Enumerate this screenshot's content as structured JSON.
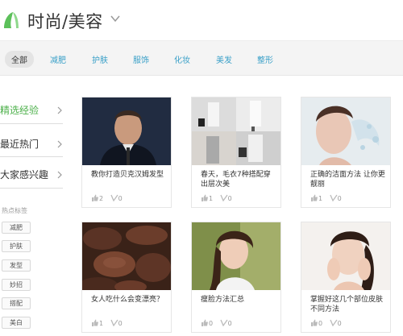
{
  "header": {
    "title": "时尚/美容"
  },
  "categories": [
    {
      "label": "全部",
      "active": true
    },
    {
      "label": "减肥"
    },
    {
      "label": "护肤"
    },
    {
      "label": "服饰"
    },
    {
      "label": "化妆"
    },
    {
      "label": "美发"
    },
    {
      "label": "整形"
    }
  ],
  "sidebar": {
    "items": [
      {
        "label": "精选经验",
        "active": true
      },
      {
        "label": "最近热门"
      },
      {
        "label": "大家感兴趣"
      }
    ],
    "hot_title": "热点标签",
    "tags": [
      "减肥",
      "护肤",
      "发型",
      "妙招",
      "搭配",
      "美白"
    ]
  },
  "cards": [
    {
      "title": "教你打造贝克汉姆发型",
      "likes": "2",
      "votes": "0"
    },
    {
      "title": "春天，毛衣7种搭配穿出层次美",
      "likes": "1",
      "votes": "0"
    },
    {
      "title": "正确的洁面方法 让你更靓丽",
      "likes": "1",
      "votes": "0"
    },
    {
      "title": "女人吃什么会变漂亮？",
      "likes": "1",
      "votes": "0"
    },
    {
      "title": "瘦脸方法汇总",
      "likes": "0",
      "votes": "0"
    },
    {
      "title": "掌握好这几个部位皮肤不同方法",
      "likes": "0",
      "votes": "0"
    }
  ],
  "colors": {
    "accent_green": "#4cb04a",
    "link_blue": "#3aa0c8"
  }
}
